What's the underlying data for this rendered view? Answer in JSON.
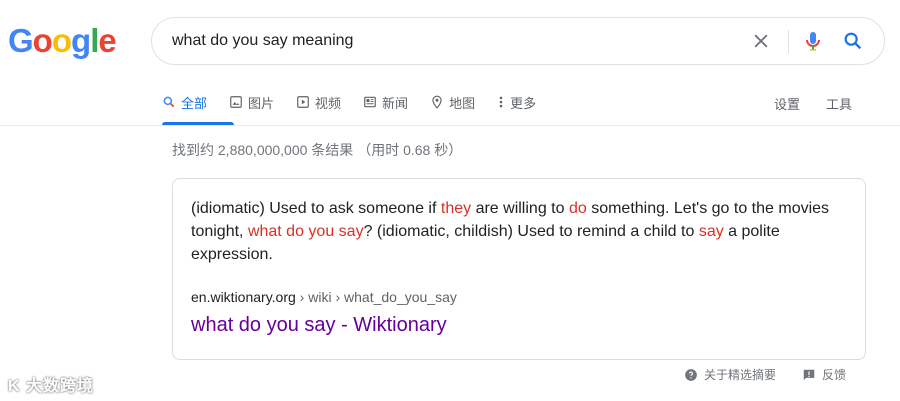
{
  "logo": {
    "letters": [
      "G",
      "o",
      "o",
      "g",
      "l",
      "e"
    ],
    "colors": [
      "#4285f4",
      "#ea4335",
      "#fbbc05",
      "#4285f4",
      "#34a853",
      "#ea4335"
    ]
  },
  "search": {
    "query": "what do you say meaning"
  },
  "tabs": [
    {
      "label": "全部",
      "icon": "search-icon"
    },
    {
      "label": "图片",
      "icon": "image-icon"
    },
    {
      "label": "视频",
      "icon": "video-icon"
    },
    {
      "label": "新闻",
      "icon": "news-icon"
    },
    {
      "label": "地图",
      "icon": "map-pin-icon"
    },
    {
      "label": "更多",
      "icon": "more-vert-icon"
    }
  ],
  "tools": {
    "settings": "设置",
    "tools": "工具"
  },
  "stats": "找到约 2,880,000,000 条结果 （用时 0.68 秒）",
  "snippet": {
    "p1": "(idiomatic) Used to ask someone if ",
    "h1": "they",
    "p2": " are willing to ",
    "h2": "do",
    "p3": " something. Let's go to the movies tonight, ",
    "h3": "what do you say",
    "p4": "? (idiomatic, childish) Used to remind a child to ",
    "h4": "say",
    "p5": " a polite expression."
  },
  "cite": {
    "domain": "en.wiktionary.org",
    "path": " › wiki › what_do_you_say"
  },
  "result_title": "what do you say - Wiktionary",
  "footer": {
    "about": "关于精选摘要",
    "feedback": "反馈"
  },
  "watermark": "K 大数跨境",
  "colors": {
    "accent": "#1a73e8",
    "highlight": "#d93025",
    "visited": "#660099"
  }
}
